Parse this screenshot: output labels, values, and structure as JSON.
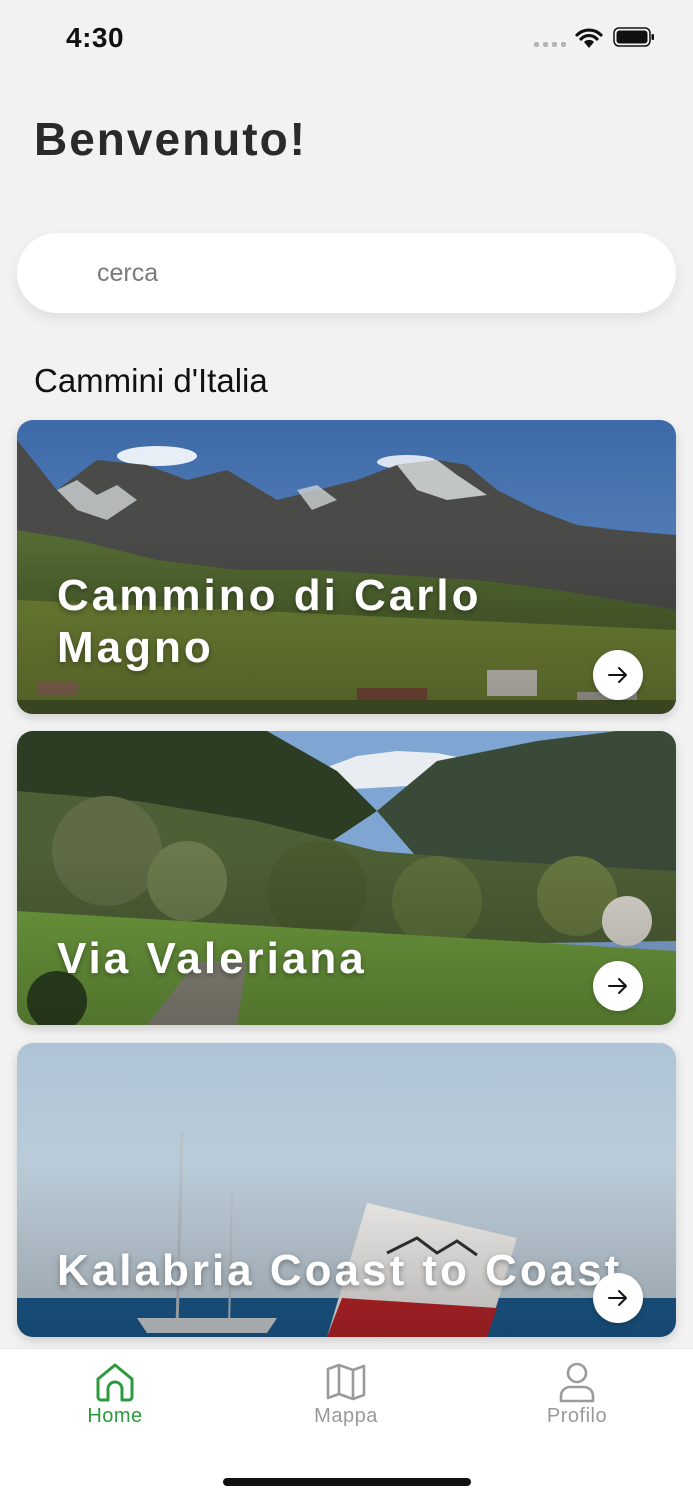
{
  "status_bar": {
    "time": "4:30"
  },
  "header": {
    "title": "Benvenuto!"
  },
  "search": {
    "placeholder": "cerca"
  },
  "section": {
    "title": "Cammini d'Italia"
  },
  "cards": [
    {
      "title": "Cammino di Carlo Magno"
    },
    {
      "title": "Via Valeriana"
    },
    {
      "title": "Kalabria Coast to Coast"
    }
  ],
  "tabbar": {
    "items": [
      {
        "label": "Home",
        "icon": "home-icon",
        "active": true
      },
      {
        "label": "Mappa",
        "icon": "map-icon",
        "active": false
      },
      {
        "label": "Profilo",
        "icon": "profile-icon",
        "active": false
      }
    ]
  },
  "colors": {
    "accent": "#2c9a3e",
    "background": "#f2f2f2",
    "inactive": "#9a9a9a"
  }
}
